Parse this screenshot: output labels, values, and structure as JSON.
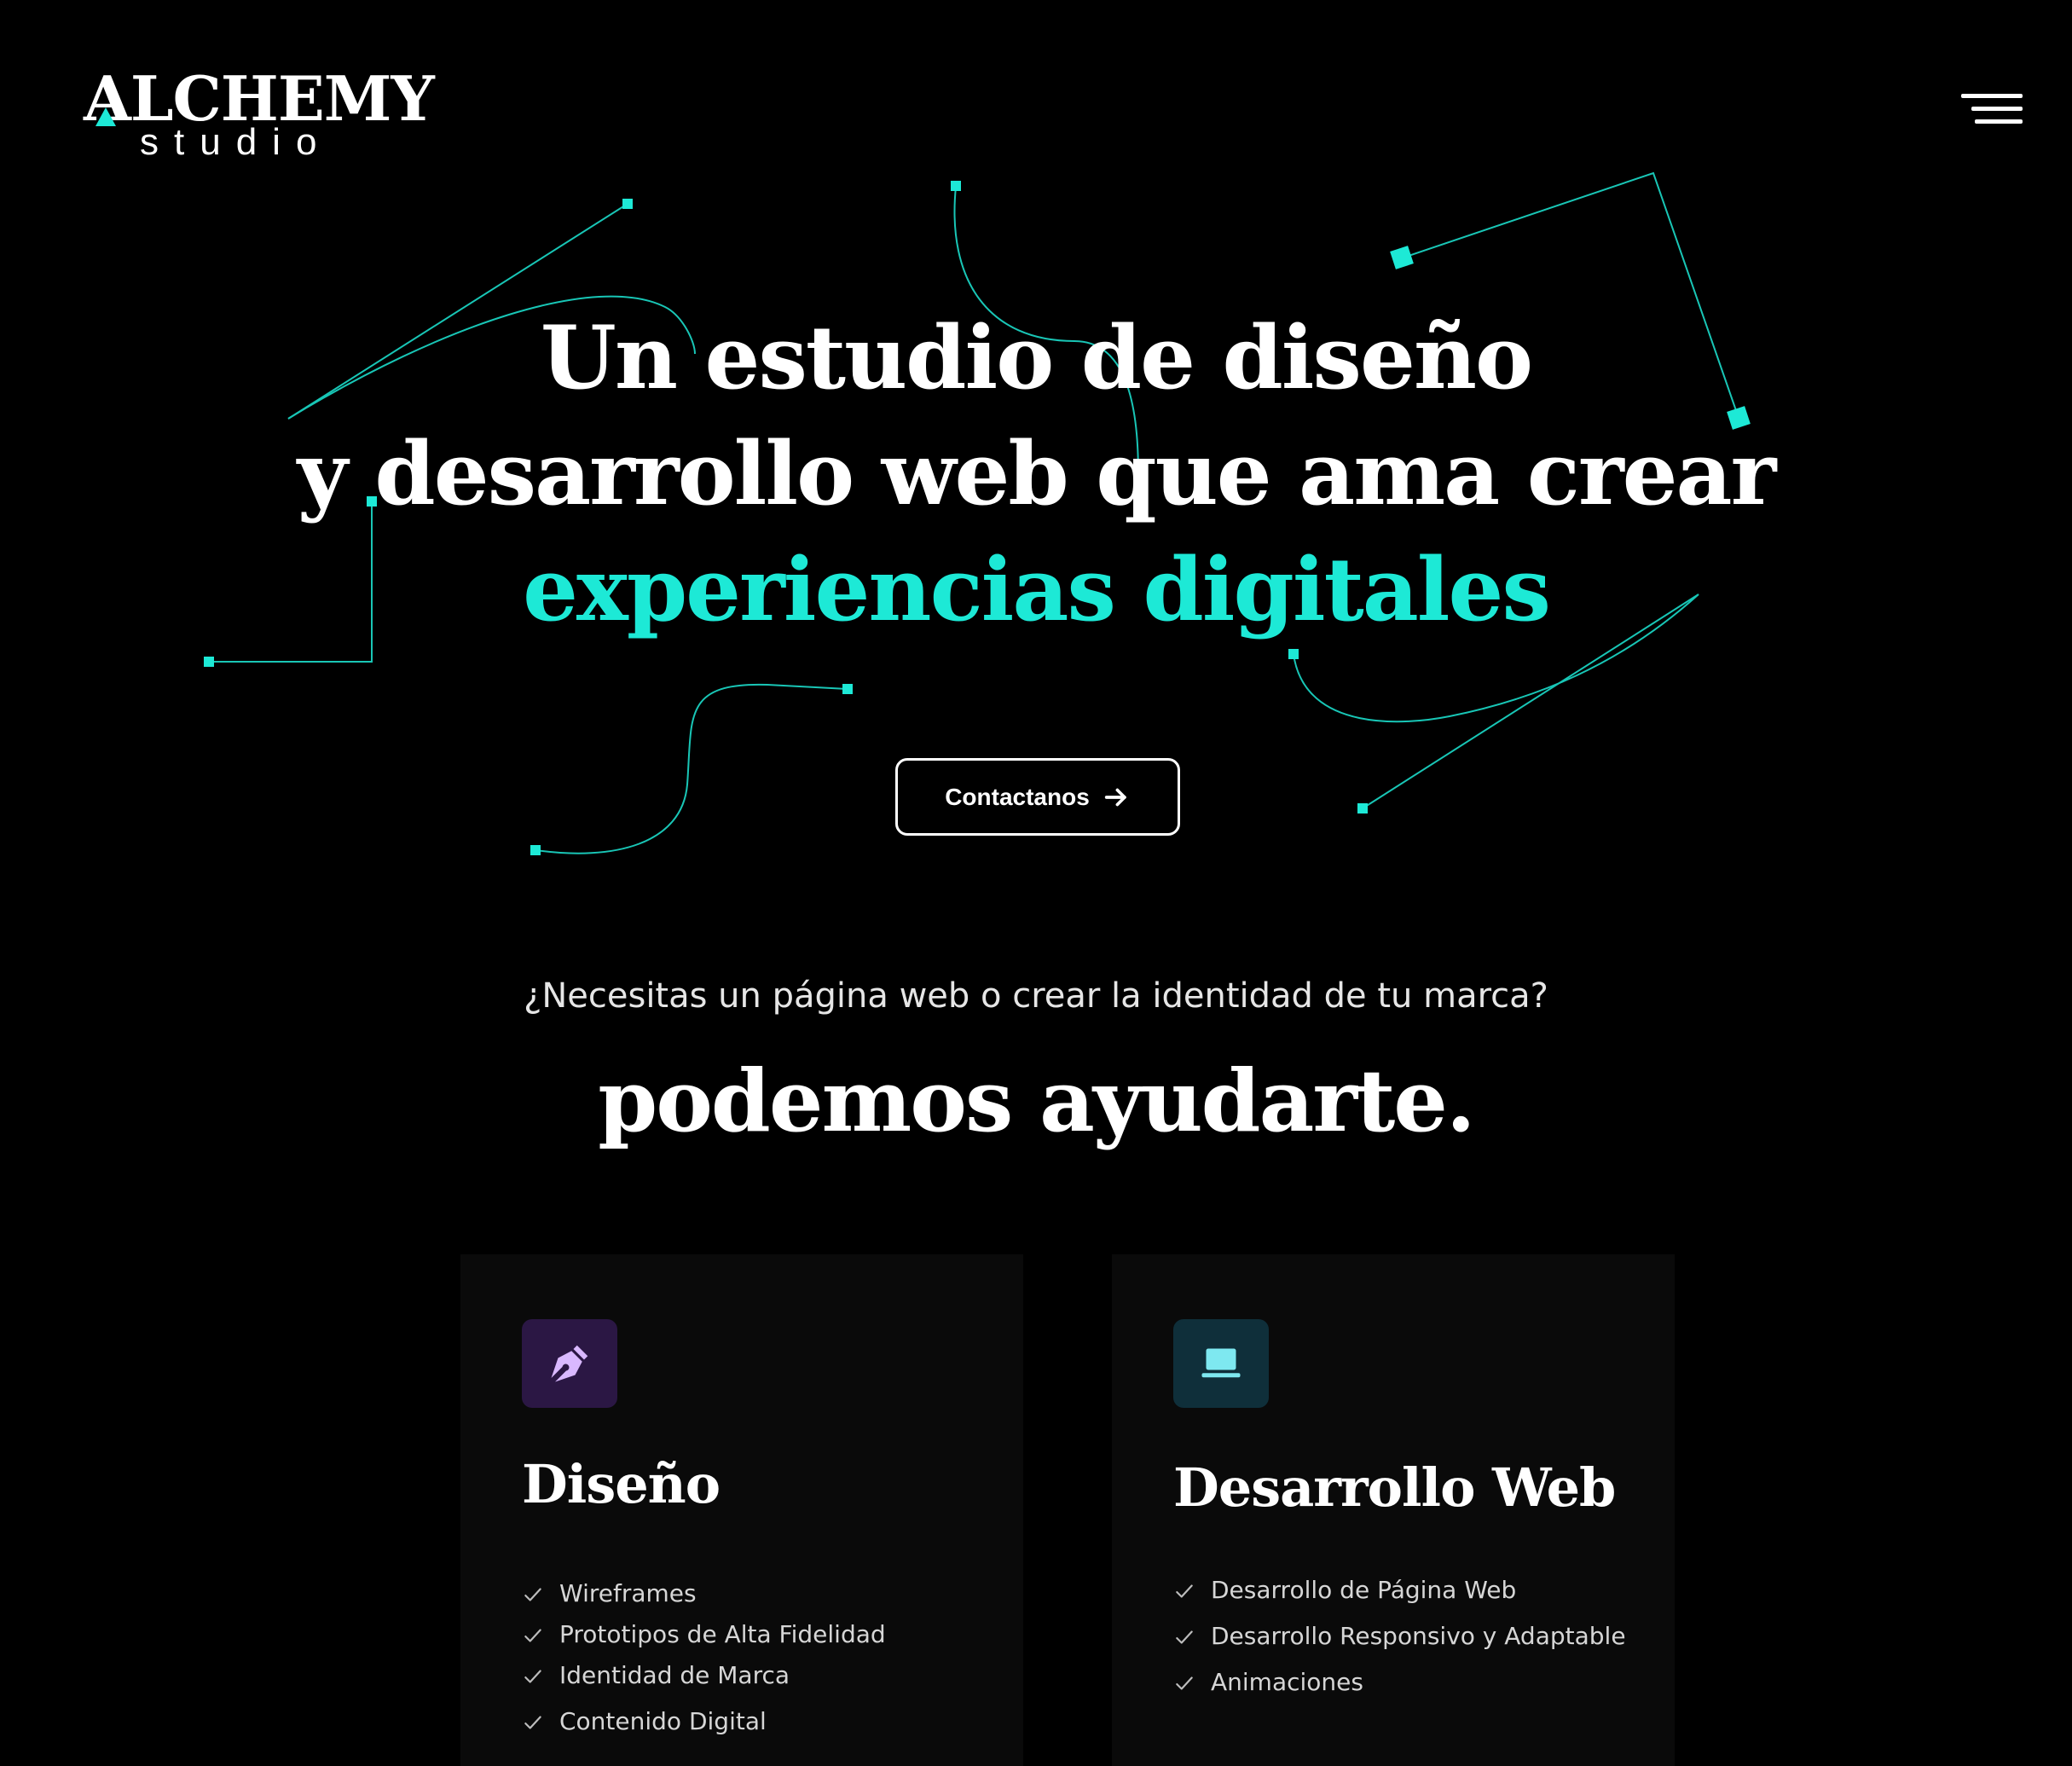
{
  "header": {
    "logo_main_a": "A",
    "logo_main_rest": "LCHEMY",
    "logo_sub": "studio",
    "menu_icon": "hamburger-menu-icon"
  },
  "hero": {
    "title_line1": "Un estudio de diseño",
    "title_line2": "y desarrollo web que ama crear",
    "title_accent": "experiencias digitales",
    "cta_label": "Contactanos",
    "cta_icon": "arrow-right-icon"
  },
  "intro": {
    "question": "¿Necesitas un página web o  crear la identidad de tu marca?",
    "heading": "podemos ayudarte."
  },
  "services": [
    {
      "icon": "pen-tool-icon",
      "title": "Diseño",
      "items": [
        "Wireframes",
        "Prototipos de Alta Fidelidad",
        "Identidad de Marca",
        "Contenido Digital"
      ]
    },
    {
      "icon": "laptop-icon",
      "title": "Desarrollo Web",
      "items": [
        "Desarrollo de Página Web",
        "Desarrollo Responsivo y Adaptable",
        "Animaciones"
      ]
    }
  ],
  "colors": {
    "background": "#000000",
    "accent": "#1de9d6",
    "text": "#ffffff",
    "card_background": "#0a0a0a",
    "design_icon_bg": "#2b1744",
    "design_icon_fg": "#d9b8ff",
    "web_icon_bg": "#0f2f3a",
    "web_icon_fg": "#7ee8f0"
  }
}
